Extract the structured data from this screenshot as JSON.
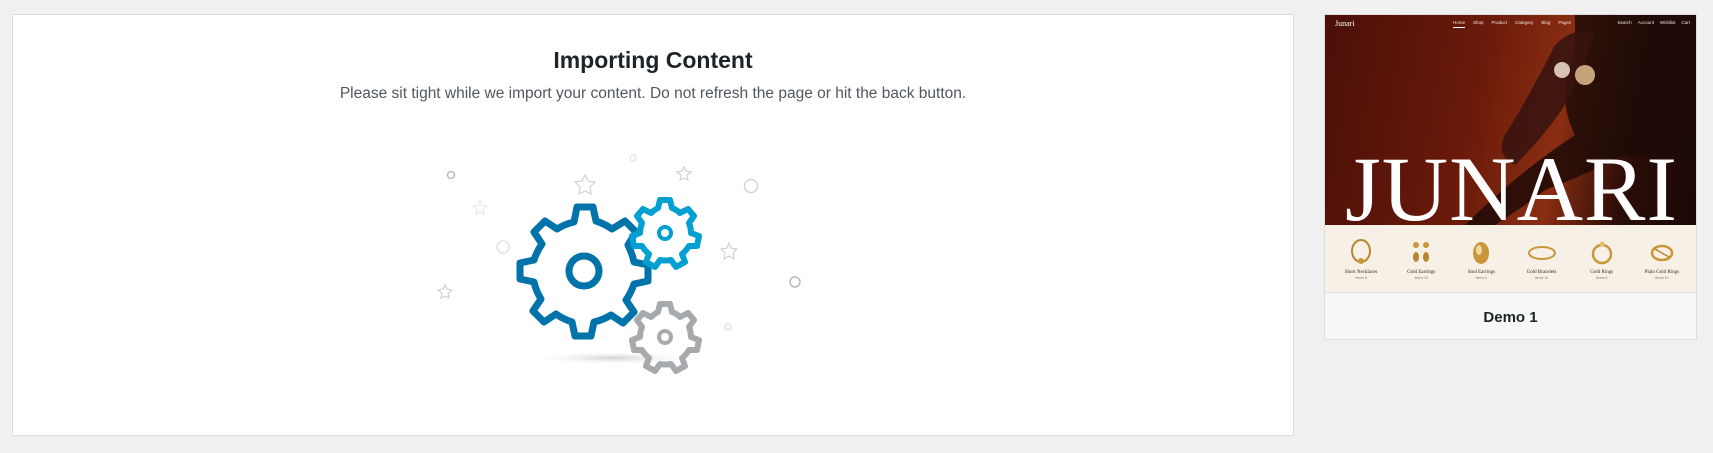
{
  "import_panel": {
    "title": "Importing Content",
    "subtitle": "Please sit tight while we import your content. Do not refresh the page or hit the back button."
  },
  "colors": {
    "gear_large": "#0073aa",
    "gear_small": "#00a0d2",
    "gear_gray": "#a7aaad"
  },
  "demo": {
    "label": "Demo 1",
    "site": {
      "logo": "Junari",
      "nav": [
        "Home",
        "Shop",
        "Product",
        "Category",
        "Blog",
        "Pages"
      ],
      "actions": [
        "Search",
        "Account",
        "Wishlist",
        "Cart"
      ],
      "wordmark": "JUNARI"
    },
    "products": [
      {
        "name": "Short Necklaces",
        "count": "Items 6"
      },
      {
        "name": "Gold Earrings",
        "count": "Items 10"
      },
      {
        "name": "Stud Earrings",
        "count": "Items 6"
      },
      {
        "name": "Gold Bracelets",
        "count": "Items 10"
      },
      {
        "name": "Gold Rings",
        "count": "Items 6"
      },
      {
        "name": "Plain Gold Rings",
        "count": "Items 10"
      }
    ]
  }
}
